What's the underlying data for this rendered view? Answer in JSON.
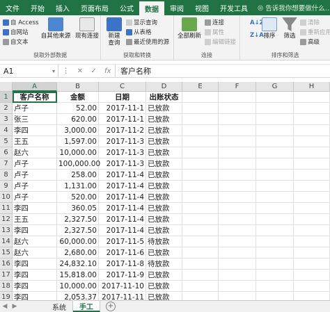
{
  "ribbon_tabs": [
    "文件",
    "开始",
    "插入",
    "页面布局",
    "公式",
    "数据",
    "审阅",
    "视图",
    "开发工具"
  ],
  "active_tab": "数据",
  "tell_me": "告诉我你想要做什么...",
  "groups": {
    "external": {
      "access": "自 Access",
      "web": "自网站",
      "text": "自文本",
      "other": "自其他来源",
      "existing": "现有连接",
      "label": "获取外部数据"
    },
    "transform": {
      "new_query": "新建\n查询",
      "show_queries": "显示查询",
      "from_table": "从表格",
      "recent": "最近使用的源",
      "label": "获取和转换"
    },
    "connections": {
      "refresh_all": "全部刷新",
      "connections": "连接",
      "properties": "属性",
      "edit_links": "编辑链接",
      "label": "连接"
    },
    "sort": {
      "sort": "排序",
      "filter": "筛选",
      "clear": "清除",
      "reapply": "重新应用",
      "advanced": "高级",
      "label": "排序和筛选"
    }
  },
  "formula_bar": {
    "name_box": "A1",
    "fx": "fx",
    "content": "客户名称"
  },
  "columns": [
    "A",
    "B",
    "C",
    "D",
    "E",
    "F",
    "G",
    "H"
  ],
  "headers": [
    "客户名称",
    "金额",
    "日期",
    "出账状态"
  ],
  "rows": [
    [
      "卢子",
      "52.00",
      "2017-11-1",
      "已放款"
    ],
    [
      "张三",
      "620.00",
      "2017-11-1",
      "已放款"
    ],
    [
      "李四",
      "3,000.00",
      "2017-11-2",
      "已放款"
    ],
    [
      "王五",
      "1,597.00",
      "2017-11-3",
      "已放款"
    ],
    [
      "赵六",
      "10,000.00",
      "2017-11-3",
      "已放款"
    ],
    [
      "卢子",
      "100,000.00",
      "2017-11-3",
      "已放款"
    ],
    [
      "卢子",
      "258.00",
      "2017-11-4",
      "已放款"
    ],
    [
      "卢子",
      "1,131.00",
      "2017-11-4",
      "已放款"
    ],
    [
      "卢子",
      "520.00",
      "2017-11-4",
      "已放款"
    ],
    [
      "李四",
      "360.05",
      "2017-11-4",
      "已放款"
    ],
    [
      "王五",
      "2,327.50",
      "2017-11-4",
      "已放款"
    ],
    [
      "李四",
      "2,327.50",
      "2017-11-4",
      "已放款"
    ],
    [
      "赵六",
      "60,000.00",
      "2017-11-5",
      "待放款"
    ],
    [
      "赵六",
      "2,680.00",
      "2017-11-6",
      "已放款"
    ],
    [
      "李四",
      "24,832.10",
      "2017-11-8",
      "待放款"
    ],
    [
      "李四",
      "15,818.00",
      "2017-11-9",
      "已放款"
    ],
    [
      "李四",
      "10,000.00",
      "2017-11-10",
      "已放款"
    ],
    [
      "李四",
      "2,053.37",
      "2017-11-11",
      "已放款"
    ]
  ],
  "sheets": [
    "系统",
    "手工"
  ],
  "active_sheet": "手工",
  "add_sheet": "+",
  "colors": {
    "accent": "#217346"
  }
}
